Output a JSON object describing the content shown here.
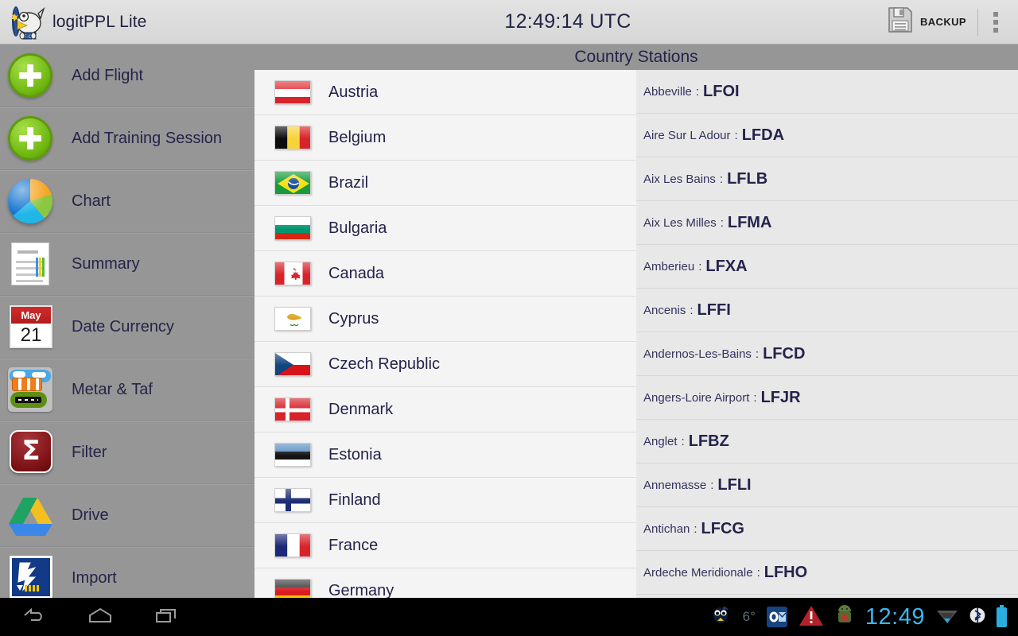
{
  "topbar": {
    "app_title": "logitPPL Lite",
    "clock": "12:49:14 UTC",
    "backup_label": "BACKUP",
    "logo_icon": "bird-plane-logo",
    "save_icon": "floppy-disk-icon",
    "overflow_icon": "overflow-menu-icon"
  },
  "sidebar": {
    "items": [
      {
        "label": "Add Flight",
        "icon": "plus-circle-icon"
      },
      {
        "label": "Add Training Session",
        "icon": "plus-circle-icon"
      },
      {
        "label": "Chart",
        "icon": "pie-chart-icon"
      },
      {
        "label": "Summary",
        "icon": "document-icon"
      },
      {
        "label": "Date Currency",
        "icon": "calendar-icon",
        "cal_month": "May",
        "cal_day": "21"
      },
      {
        "label": "Metar & Taf",
        "icon": "windsock-runway-icon"
      },
      {
        "label": "Filter",
        "icon": "sigma-icon",
        "glyph": "Σ"
      },
      {
        "label": "Drive",
        "icon": "google-drive-icon"
      },
      {
        "label": "Import",
        "icon": "import-icon"
      }
    ]
  },
  "main": {
    "title": "Country Stations"
  },
  "countries": [
    {
      "name": "Austria",
      "flag": "flag-austria"
    },
    {
      "name": "Belgium",
      "flag": "flag-belgium"
    },
    {
      "name": "Brazil",
      "flag": "flag-brazil"
    },
    {
      "name": "Bulgaria",
      "flag": "flag-bulgaria"
    },
    {
      "name": "Canada",
      "flag": "flag-canada"
    },
    {
      "name": "Cyprus",
      "flag": "flag-cyprus"
    },
    {
      "name": "Czech Republic",
      "flag": "flag-czech-republic"
    },
    {
      "name": "Denmark",
      "flag": "flag-denmark"
    },
    {
      "name": "Estonia",
      "flag": "flag-estonia"
    },
    {
      "name": "Finland",
      "flag": "flag-finland"
    },
    {
      "name": "France",
      "flag": "flag-france"
    },
    {
      "name": "Germany",
      "flag": "flag-germany"
    }
  ],
  "stations": [
    {
      "name": "Abbeville",
      "code": "LFOI"
    },
    {
      "name": "Aire Sur L Adour",
      "code": "LFDA"
    },
    {
      "name": "Aix Les Bains",
      "code": "LFLB"
    },
    {
      "name": "Aix Les Milles",
      "code": "LFMA"
    },
    {
      "name": "Amberieu",
      "code": "LFXA"
    },
    {
      "name": "Ancenis",
      "code": "LFFI"
    },
    {
      "name": "Andernos-Les-Bains",
      "code": "LFCD"
    },
    {
      "name": "Angers-Loire Airport",
      "code": "LFJR"
    },
    {
      "name": "Anglet",
      "code": "LFBZ"
    },
    {
      "name": "Annemasse",
      "code": "LFLI"
    },
    {
      "name": "Antichan",
      "code": "LFCG"
    },
    {
      "name": "Ardeche Meridionale",
      "code": "LFHO"
    }
  ],
  "station_separator": ":",
  "systembar": {
    "back_icon": "back-arrow-icon",
    "home_icon": "home-icon",
    "recents_icon": "recent-apps-icon",
    "bird_icon": "twitter-bird-icon",
    "temperature": "6°",
    "outlook_icon": "outlook-icon",
    "warning_icon": "warning-triangle-icon",
    "android_icon": "android-error-icon",
    "clock": "12:49",
    "wifi_icon": "wifi-icon",
    "bluetooth_icon": "bluetooth-icon",
    "battery_icon": "battery-icon"
  },
  "colors": {
    "topbar_bg": "#dcdcdc",
    "sidebar_bg": "#969696",
    "country_pane_bg": "#f4f4f4",
    "station_pane_bg": "#e8e8e8",
    "text_navy": "#23234c",
    "accent_green": "#6eb610",
    "system_clock_blue": "#3ab8ef"
  }
}
